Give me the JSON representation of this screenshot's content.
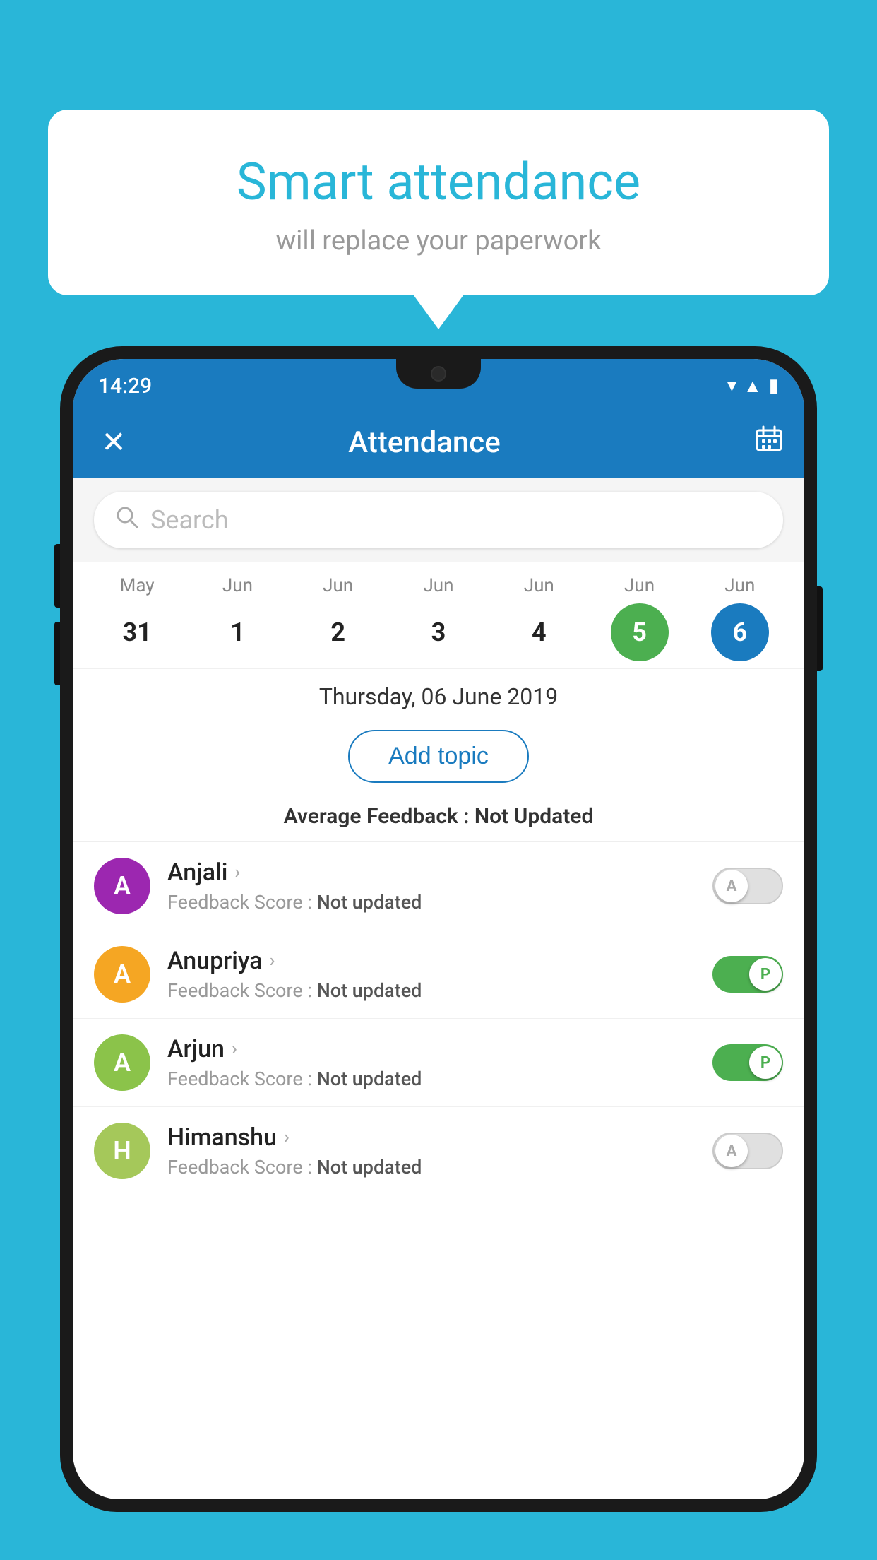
{
  "background": {
    "color": "#29b6d8"
  },
  "speech_bubble": {
    "title": "Smart attendance",
    "subtitle": "will replace your paperwork"
  },
  "status_bar": {
    "time": "14:29",
    "wifi_icon": "▾",
    "signal_icon": "▲",
    "battery_icon": "▮"
  },
  "header": {
    "close_icon": "✕",
    "title": "Attendance",
    "calendar_icon": "📅"
  },
  "search": {
    "placeholder": "Search"
  },
  "calendar": {
    "dates": [
      {
        "month": "May",
        "day": "31",
        "style": "normal"
      },
      {
        "month": "Jun",
        "day": "1",
        "style": "normal"
      },
      {
        "month": "Jun",
        "day": "2",
        "style": "normal"
      },
      {
        "month": "Jun",
        "day": "3",
        "style": "normal"
      },
      {
        "month": "Jun",
        "day": "4",
        "style": "normal"
      },
      {
        "month": "Jun",
        "day": "5",
        "style": "today"
      },
      {
        "month": "Jun",
        "day": "6",
        "style": "selected"
      }
    ]
  },
  "selected_date": {
    "full": "Thursday, 06 June 2019"
  },
  "add_topic": {
    "label": "Add topic"
  },
  "avg_feedback": {
    "label": "Average Feedback : ",
    "value": "Not Updated"
  },
  "students": [
    {
      "name": "Anjali",
      "initial": "A",
      "avatar_color": "#9c27b0",
      "feedback": "Feedback Score : ",
      "feedback_value": "Not updated",
      "toggle_state": "off",
      "toggle_label": "A"
    },
    {
      "name": "Anupriya",
      "initial": "A",
      "avatar_color": "#f5a623",
      "feedback": "Feedback Score : ",
      "feedback_value": "Not updated",
      "toggle_state": "on",
      "toggle_label": "P"
    },
    {
      "name": "Arjun",
      "initial": "A",
      "avatar_color": "#8bc34a",
      "feedback": "Feedback Score : ",
      "feedback_value": "Not updated",
      "toggle_state": "on",
      "toggle_label": "P"
    },
    {
      "name": "Himanshu",
      "initial": "H",
      "avatar_color": "#a5c85a",
      "feedback": "Feedback Score : ",
      "feedback_value": "Not updated",
      "toggle_state": "off",
      "toggle_label": "A"
    }
  ]
}
